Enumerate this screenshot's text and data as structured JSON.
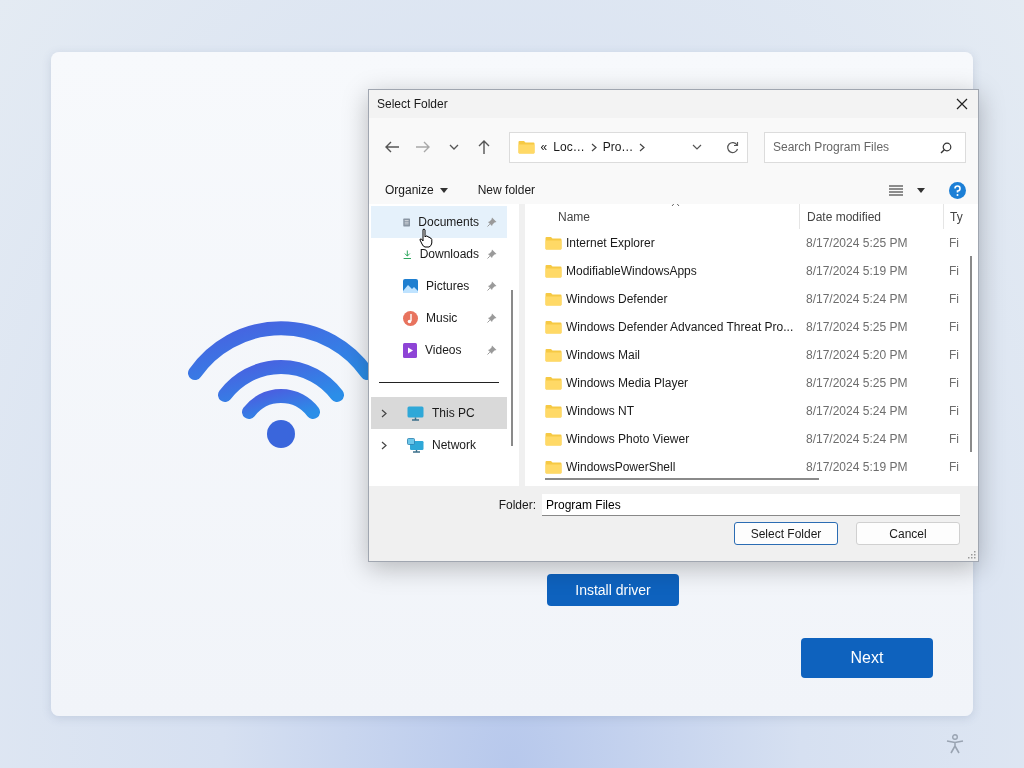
{
  "setup_card": {
    "install_button": "Install driver",
    "next_button": "Next"
  },
  "dialog": {
    "title": "Select Folder",
    "nav_buttons": [
      {
        "kind": "back",
        "disabled": false
      },
      {
        "kind": "forward",
        "disabled": true
      },
      {
        "kind": "recent",
        "disabled": false
      },
      {
        "kind": "up",
        "disabled": false
      }
    ],
    "address": {
      "overflow": "«",
      "crumbs": [
        "Loc…",
        "Pro…"
      ]
    },
    "search": {
      "placeholder": "Search Program Files"
    },
    "toolbar": {
      "organize": "Organize",
      "new_folder": "New folder"
    },
    "quick_access": [
      {
        "label": "Documents",
        "kind": "documents",
        "hovered": true,
        "pinned": true
      },
      {
        "label": "Downloads",
        "kind": "downloads",
        "hovered": false,
        "pinned": true
      },
      {
        "label": "Pictures",
        "kind": "pictures",
        "hovered": false,
        "pinned": true
      },
      {
        "label": "Music",
        "kind": "music",
        "hovered": false,
        "pinned": true
      },
      {
        "label": "Videos",
        "kind": "videos",
        "hovered": false,
        "pinned": true
      }
    ],
    "tree": [
      {
        "label": "This PC",
        "kind": "pc",
        "selected": true
      },
      {
        "label": "Network",
        "kind": "network",
        "selected": false
      }
    ],
    "columns": [
      "Name",
      "Date modified",
      "Ty"
    ],
    "rows": [
      {
        "name": "Internet Explorer",
        "date": "8/17/2024 5:25 PM",
        "type": "Fi"
      },
      {
        "name": "ModifiableWindowsApps",
        "date": "8/17/2024 5:19 PM",
        "type": "Fi"
      },
      {
        "name": "Windows Defender",
        "date": "8/17/2024 5:24 PM",
        "type": "Fi"
      },
      {
        "name": "Windows Defender Advanced Threat Pro...",
        "date": "8/17/2024 5:25 PM",
        "type": "Fi"
      },
      {
        "name": "Windows Mail",
        "date": "8/17/2024 5:20 PM",
        "type": "Fi"
      },
      {
        "name": "Windows Media Player",
        "date": "8/17/2024 5:25 PM",
        "type": "Fi"
      },
      {
        "name": "Windows NT",
        "date": "8/17/2024 5:24 PM",
        "type": "Fi"
      },
      {
        "name": "Windows Photo Viewer",
        "date": "8/17/2024 5:24 PM",
        "type": "Fi"
      },
      {
        "name": "WindowsPowerShell",
        "date": "8/17/2024 5:19 PM",
        "type": "Fi"
      }
    ],
    "folder_label": "Folder:",
    "folder_value": "Program Files",
    "buttons": [
      {
        "label": "Select Folder",
        "default": true
      },
      {
        "label": "Cancel",
        "default": false
      }
    ]
  }
}
